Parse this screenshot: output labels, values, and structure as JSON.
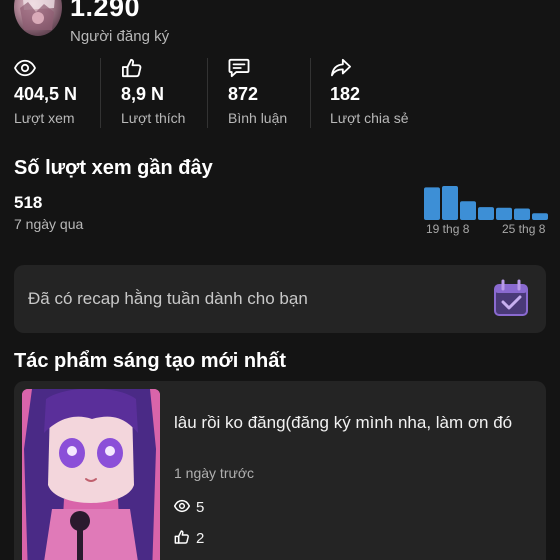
{
  "profile": {
    "followers_count": "1.290",
    "followers_label": "Người đăng ký"
  },
  "stats": [
    {
      "icon": "eye-icon",
      "value": "404,5 N",
      "label": "Lượt xem"
    },
    {
      "icon": "thumbs-up-icon",
      "value": "8,9 N",
      "label": "Lượt thích"
    },
    {
      "icon": "comment-icon",
      "value": "872",
      "label": "Bình luận"
    },
    {
      "icon": "share-icon",
      "value": "182",
      "label": "Lượt chia sẻ"
    }
  ],
  "recent_views": {
    "title": "Số lượt xem gần đây",
    "count": "518",
    "period": "7 ngày qua",
    "tick_start": "19 thg 8",
    "tick_end": "25 thg 8"
  },
  "chart_data": {
    "type": "bar",
    "categories": [
      "19 thg 8",
      "",
      "",
      "",
      "",
      "",
      "25 thg 8"
    ],
    "values": [
      96,
      100,
      55,
      38,
      36,
      34,
      20
    ],
    "color": "#3d8fd6"
  },
  "recap": {
    "text": "Đã có recap hằng tuần dành cho bạn",
    "icon": "calendar-check-icon"
  },
  "new_works": {
    "title": "Tác phẩm sáng tạo mới nhất",
    "video": {
      "title": "lâu rồi ko đăng(đăng ký mình nha, làm ơn đó",
      "time": "1 ngày trước",
      "views": "5",
      "likes": "2"
    }
  },
  "colors": {
    "background": "#141414",
    "card": "#242424",
    "accent_bar": "#3d8fd6",
    "recap_icon": "#8a6ad0"
  }
}
